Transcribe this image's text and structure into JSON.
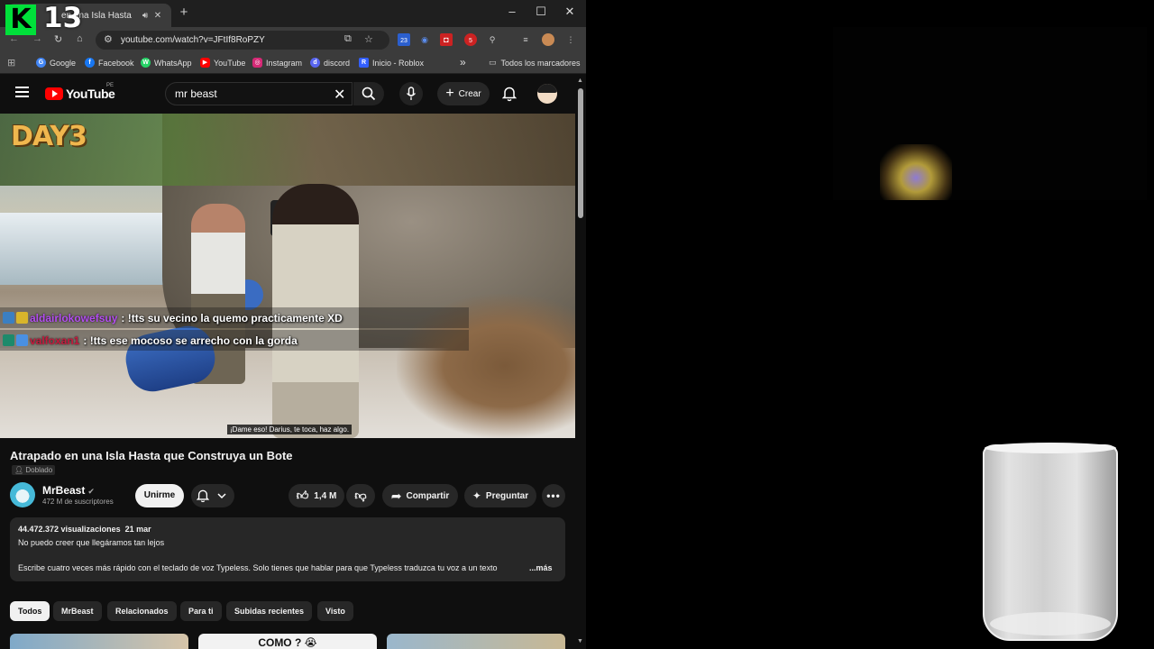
{
  "overlay": {
    "logo_letter": "K",
    "logo_number": "13"
  },
  "browser": {
    "tab_title": "en una Isla Hasta",
    "url": "youtube.com/watch?v=JFtIf8RoPZY",
    "bookmarks": [
      {
        "label": "Google",
        "color": "#4285f4",
        "glyph": "G"
      },
      {
        "label": "Facebook",
        "color": "#1877f2",
        "glyph": "f"
      },
      {
        "label": "WhatsApp",
        "color": "#25d366",
        "glyph": "W"
      },
      {
        "label": "YouTube",
        "color": "#ff0000",
        "glyph": "▶"
      },
      {
        "label": "Instagram",
        "color": "#d62976",
        "glyph": "◎"
      },
      {
        "label": "discord",
        "color": "#5865f2",
        "glyph": "d"
      },
      {
        "label": "Inicio - Roblox",
        "color": "#335fff",
        "glyph": "R"
      }
    ],
    "more_bookmarks_glyph": "»",
    "all_bookmarks": "Todos los marcadores",
    "extension_badges": [
      "23",
      "5"
    ]
  },
  "youtube": {
    "logo_text": "YouTube",
    "country_code": "PE",
    "search_value": "mr beast",
    "create_label": "Crear",
    "create_glyph": "+"
  },
  "video": {
    "overlay_text": "DAY3",
    "chat": [
      {
        "user": "aldairlokowefsuy",
        "message": ": !tts su vecino la quemo practicamente XD"
      },
      {
        "user": "valfoxan1",
        "message": ": !tts ese mocoso se arrecho con la gorda"
      }
    ],
    "subtitle": "¡Dame eso! Darius, te toca, haz algo."
  },
  "info": {
    "title": "Atrapado en una Isla Hasta que Construya un Bote",
    "dubbed": "Doblado",
    "channel": "MrBeast",
    "subscribers": "472 M de suscriptores",
    "join_label": "Unirme",
    "likes": "1,4 M",
    "share_label": "Compartir",
    "ask_label": "Preguntar",
    "views": "44.472.372 visualizaciones",
    "date": "21 mar",
    "desc_line1": "No puedo creer que llegáramos tan lejos",
    "desc_line2": "Escribe cuatro veces más rápido con el teclado de voz Typeless. Solo tienes que hablar para que Typeless traduzca tu voz a un texto",
    "more_label": "...más"
  },
  "chips": [
    "Todos",
    "MrBeast",
    "Relacionados",
    "Para ti",
    "Subidas recientes",
    "Visto"
  ],
  "thumbnail_texts": [
    "COMO ? 😭"
  ]
}
